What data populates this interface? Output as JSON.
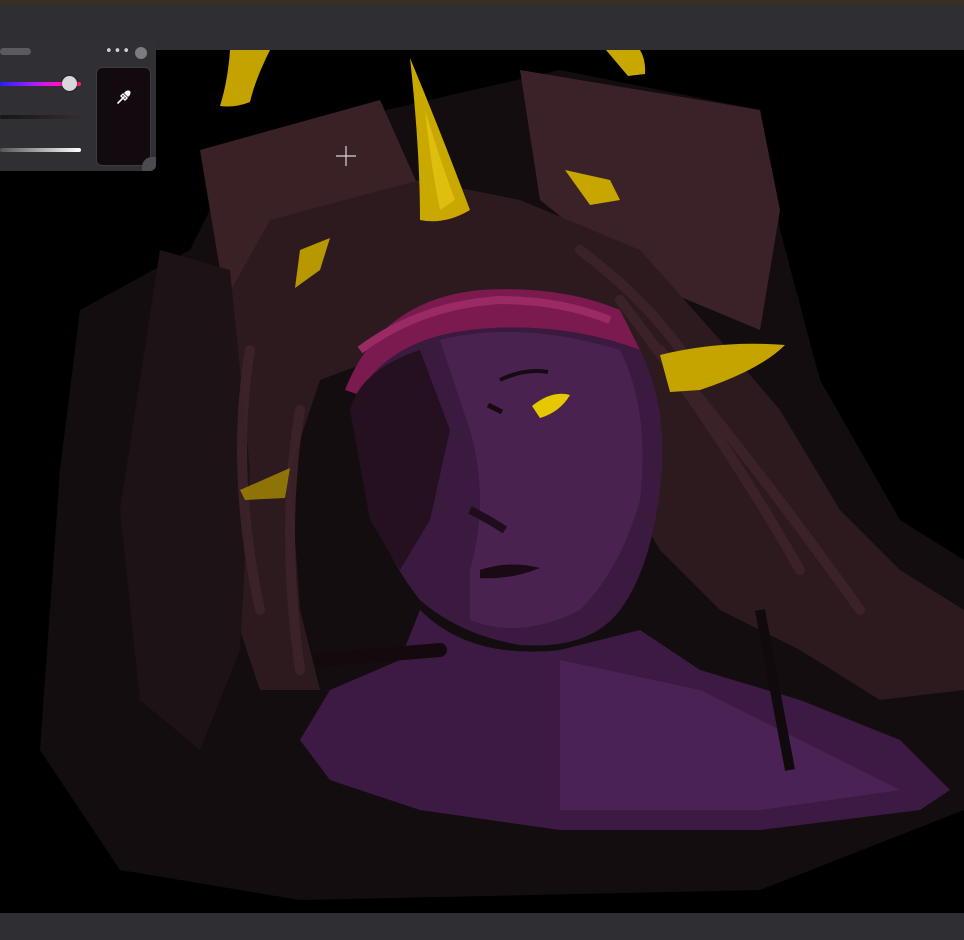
{
  "app": {
    "canvas_background": "#000000",
    "accent": "#c8a400"
  },
  "color_panel": {
    "menu_label": "•••",
    "current_color": "#120a0e",
    "icons": {
      "menu": "more-icon",
      "picker": "eyedropper-icon",
      "cursor": "crosshair-icon"
    }
  }
}
